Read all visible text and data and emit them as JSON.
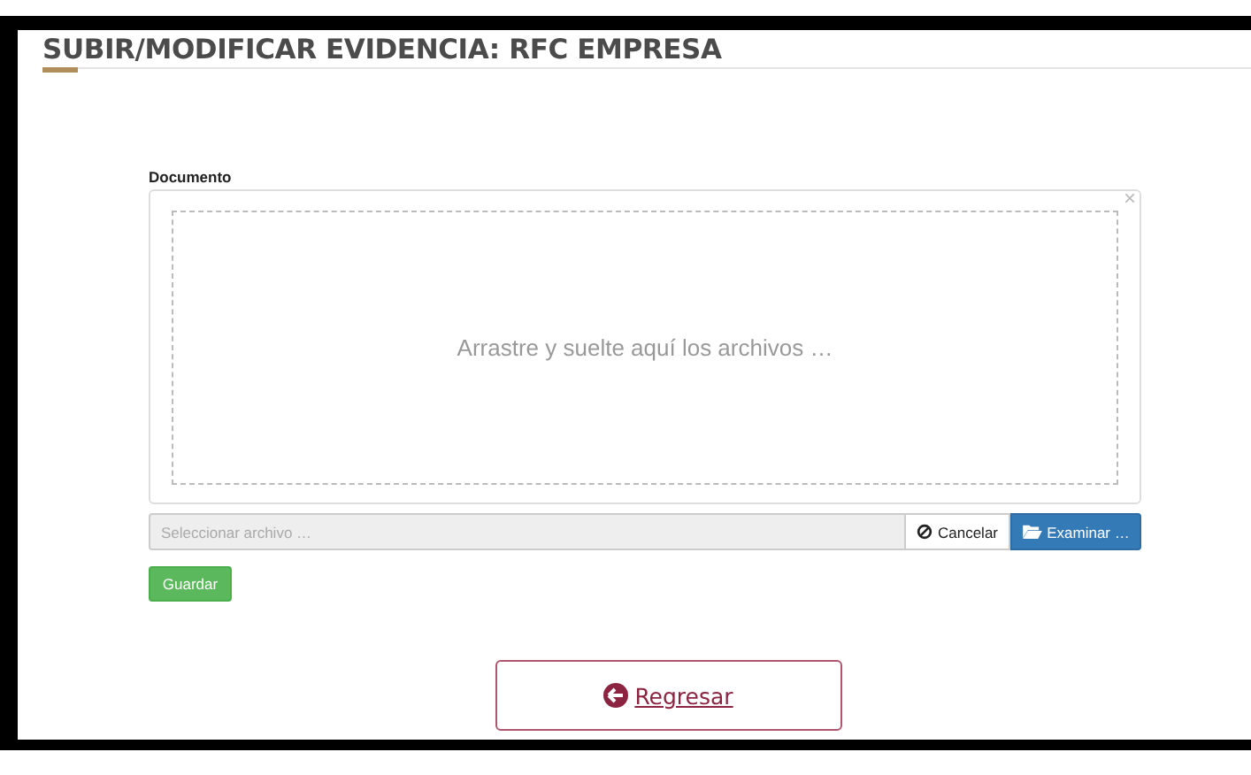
{
  "page": {
    "title": "SUBIR/MODIFICAR EVIDENCIA: RFC EMPRESA"
  },
  "upload": {
    "label": "Documento",
    "close": "×",
    "dropzone_text": "Arrastre y suelte aquí los archivos …",
    "placeholder": "Seleccionar archivo …",
    "cancel_button": "Cancelar",
    "browse_button": "Examinar …"
  },
  "save_button": "Guardar",
  "back_link": "Regresar"
}
